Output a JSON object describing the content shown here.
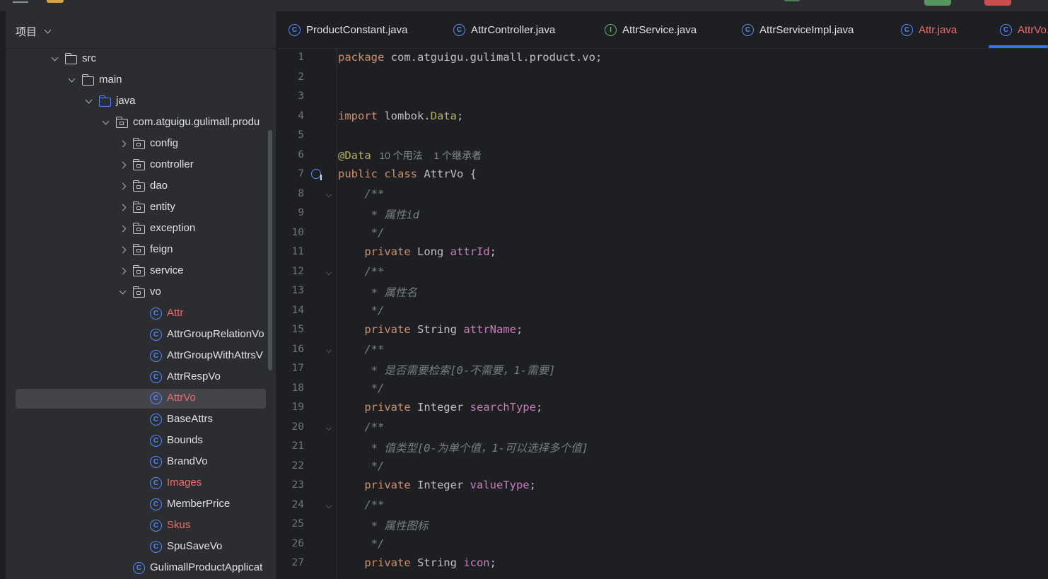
{
  "project_panel": {
    "title": "项目",
    "tree": [
      {
        "label": "src",
        "kind": "folder",
        "level": 0,
        "state": "expanded"
      },
      {
        "label": "main",
        "kind": "folder",
        "level": 1,
        "state": "expanded"
      },
      {
        "label": "java",
        "kind": "source-folder",
        "level": 2,
        "state": "expanded"
      },
      {
        "label": "com.atguigu.gulimall.produ",
        "kind": "package",
        "level": 3,
        "state": "expanded"
      },
      {
        "label": "config",
        "kind": "package",
        "level": 4,
        "state": "collapsed"
      },
      {
        "label": "controller",
        "kind": "package",
        "level": 4,
        "state": "collapsed"
      },
      {
        "label": "dao",
        "kind": "package",
        "level": 4,
        "state": "collapsed"
      },
      {
        "label": "entity",
        "kind": "package",
        "level": 4,
        "state": "collapsed"
      },
      {
        "label": "exception",
        "kind": "package",
        "level": 4,
        "state": "collapsed"
      },
      {
        "label": "feign",
        "kind": "package",
        "level": 4,
        "state": "collapsed"
      },
      {
        "label": "service",
        "kind": "package",
        "level": 4,
        "state": "collapsed"
      },
      {
        "label": "vo",
        "kind": "package",
        "level": 4,
        "state": "expanded"
      },
      {
        "label": "Attr",
        "kind": "class",
        "level": 5,
        "modified": true
      },
      {
        "label": "AttrGroupRelationVo",
        "kind": "class",
        "level": 5
      },
      {
        "label": "AttrGroupWithAttrsV",
        "kind": "class",
        "level": 5
      },
      {
        "label": "AttrRespVo",
        "kind": "class",
        "level": 5
      },
      {
        "label": "AttrVo",
        "kind": "class",
        "level": 5,
        "modified": true,
        "selected": true
      },
      {
        "label": "BaseAttrs",
        "kind": "class",
        "level": 5
      },
      {
        "label": "Bounds",
        "kind": "class",
        "level": 5
      },
      {
        "label": "BrandVo",
        "kind": "class",
        "level": 5
      },
      {
        "label": "Images",
        "kind": "class",
        "level": 5,
        "modified": true
      },
      {
        "label": "MemberPrice",
        "kind": "class",
        "level": 5
      },
      {
        "label": "Skus",
        "kind": "class",
        "level": 5,
        "modified": true
      },
      {
        "label": "SpuSaveVo",
        "kind": "class",
        "level": 5
      },
      {
        "label": "GulimallProductApplicat",
        "kind": "app-class",
        "level": 4
      }
    ]
  },
  "tabs": [
    {
      "label": "ProductConstant.java",
      "icon": "class-icon",
      "modified": false
    },
    {
      "label": "AttrController.java",
      "icon": "class-icon",
      "modified": false
    },
    {
      "label": "AttrService.java",
      "icon": "interface-icon",
      "modified": false
    },
    {
      "label": "AttrServiceImpl.java",
      "icon": "class-icon",
      "modified": false
    },
    {
      "label": "Attr.java",
      "icon": "class-icon",
      "modified": true
    },
    {
      "label": "AttrVo.java",
      "icon": "class-icon",
      "modified": true,
      "active": true
    }
  ],
  "editor": {
    "lines": [
      {
        "n": "1",
        "tokens": [
          [
            "kw",
            "package "
          ],
          [
            "plain",
            "com.atguigu.gulimall.product.vo;"
          ]
        ]
      },
      {
        "n": "2",
        "tokens": []
      },
      {
        "n": "3",
        "tokens": []
      },
      {
        "n": "4",
        "tokens": [
          [
            "kw",
            "import "
          ],
          [
            "plain",
            "lombok."
          ],
          [
            "ann",
            "Data"
          ],
          [
            "plain",
            ";"
          ]
        ]
      },
      {
        "n": "5",
        "tokens": []
      },
      {
        "n": "6",
        "tokens": [
          [
            "ann",
            "@Data"
          ],
          [
            "hint",
            "   10 个用法    1 个继承者"
          ]
        ]
      },
      {
        "n": "7",
        "tokens": [
          [
            "kw",
            "public class "
          ],
          [
            "plain",
            "AttrVo {"
          ]
        ],
        "gutter_icon": "implemented-icon"
      },
      {
        "n": "8",
        "tokens": [
          [
            "cmt",
            "    /**"
          ]
        ],
        "fold": true
      },
      {
        "n": "9",
        "tokens": [
          [
            "cmt",
            "     * 属性id"
          ]
        ]
      },
      {
        "n": "10",
        "tokens": [
          [
            "cmt",
            "     */"
          ]
        ]
      },
      {
        "n": "11",
        "tokens": [
          [
            "kw",
            "    private "
          ],
          [
            "plain",
            "Long "
          ],
          [
            "fld",
            "attrId"
          ],
          [
            "plain",
            ";"
          ]
        ]
      },
      {
        "n": "12",
        "tokens": [
          [
            "cmt",
            "    /**"
          ]
        ],
        "fold": true
      },
      {
        "n": "13",
        "tokens": [
          [
            "cmt",
            "     * 属性名"
          ]
        ]
      },
      {
        "n": "14",
        "tokens": [
          [
            "cmt",
            "     */"
          ]
        ]
      },
      {
        "n": "15",
        "tokens": [
          [
            "kw",
            "    private "
          ],
          [
            "plain",
            "String "
          ],
          [
            "fld",
            "attrName"
          ],
          [
            "plain",
            ";"
          ]
        ]
      },
      {
        "n": "16",
        "tokens": [
          [
            "cmt",
            "    /**"
          ]
        ],
        "fold": true
      },
      {
        "n": "17",
        "tokens": [
          [
            "cmt",
            "     * 是否需要检索[0-不需要，1-需要]"
          ]
        ]
      },
      {
        "n": "18",
        "tokens": [
          [
            "cmt",
            "     */"
          ]
        ]
      },
      {
        "n": "19",
        "tokens": [
          [
            "kw",
            "    private "
          ],
          [
            "plain",
            "Integer "
          ],
          [
            "fld",
            "searchType"
          ],
          [
            "plain",
            ";"
          ]
        ]
      },
      {
        "n": "20",
        "tokens": [
          [
            "cmt",
            "    /**"
          ]
        ],
        "fold": true
      },
      {
        "n": "21",
        "tokens": [
          [
            "cmt",
            "     * 值类型[0-为单个值，1-可以选择多个值]"
          ]
        ]
      },
      {
        "n": "22",
        "tokens": [
          [
            "cmt",
            "     */"
          ]
        ]
      },
      {
        "n": "23",
        "tokens": [
          [
            "kw",
            "    private "
          ],
          [
            "plain",
            "Integer "
          ],
          [
            "fld",
            "valueType"
          ],
          [
            "plain",
            ";"
          ]
        ]
      },
      {
        "n": "24",
        "tokens": [
          [
            "cmt",
            "    /**"
          ]
        ],
        "fold": true
      },
      {
        "n": "25",
        "tokens": [
          [
            "cmt",
            "     * 属性图标"
          ]
        ]
      },
      {
        "n": "26",
        "tokens": [
          [
            "cmt",
            "     */"
          ]
        ]
      },
      {
        "n": "27",
        "tokens": [
          [
            "kw",
            "    private "
          ],
          [
            "plain",
            "String "
          ],
          [
            "fld",
            "icon"
          ],
          [
            "plain",
            ";"
          ]
        ]
      }
    ]
  },
  "colors": {
    "background": "#1e1f22",
    "panel": "#2b2d30",
    "keyword": "#cf8e6d",
    "annotation": "#b3ae60",
    "field": "#c77dbb",
    "comment": "#7a7e85",
    "modified_file": "#f26a6a",
    "accent": "#3574f0"
  }
}
